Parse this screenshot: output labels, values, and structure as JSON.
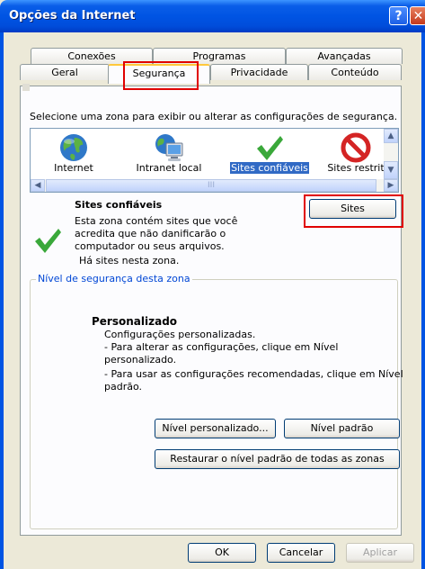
{
  "window": {
    "title": "Opções da Internet"
  },
  "tabs": {
    "row1": [
      "Conexões",
      "Programas",
      "Avançadas"
    ],
    "row2": [
      "Geral",
      "Segurança",
      "Privacidade",
      "Conteúdo"
    ],
    "active": "Segurança"
  },
  "security": {
    "instruction": "Selecione uma zona para exibir ou alterar as configurações de segurança.",
    "zones": [
      {
        "label": "Internet",
        "icon": "globe-icon"
      },
      {
        "label": "Intranet local",
        "icon": "computer-globe-icon"
      },
      {
        "label": "Sites confiáveis",
        "icon": "checkmark-icon",
        "selected": true
      },
      {
        "label": "Sites restrit",
        "icon": "restricted-icon"
      }
    ],
    "zone_title": "Sites confiáveis",
    "zone_desc": [
      "Esta zona contém sites que você",
      "acredita que não danificarão o",
      "computador ou seus arquivos.",
      "Há sites nesta zona."
    ],
    "sites_button": "Sites"
  },
  "level": {
    "group_title": "Nível de segurança desta zona",
    "title": "Personalizado",
    "lines": [
      "Configurações personalizadas.",
      "- Para alterar as configurações, clique em Nível",
      "personalizado.",
      "- Para usar as configurações recomendadas, clique em Nível",
      "padrão."
    ],
    "custom_button": "Nível personalizado...",
    "default_button": "Nível padrão",
    "restore_button": "Restaurar o nível padrão de todas as zonas"
  },
  "footer": {
    "ok": "OK",
    "cancel": "Cancelar",
    "apply": "Aplicar"
  },
  "colors": {
    "title_bar": "#0054e3",
    "selection": "#316ac5",
    "highlight_box": "#e00000",
    "check_green": "#3aa83a"
  }
}
